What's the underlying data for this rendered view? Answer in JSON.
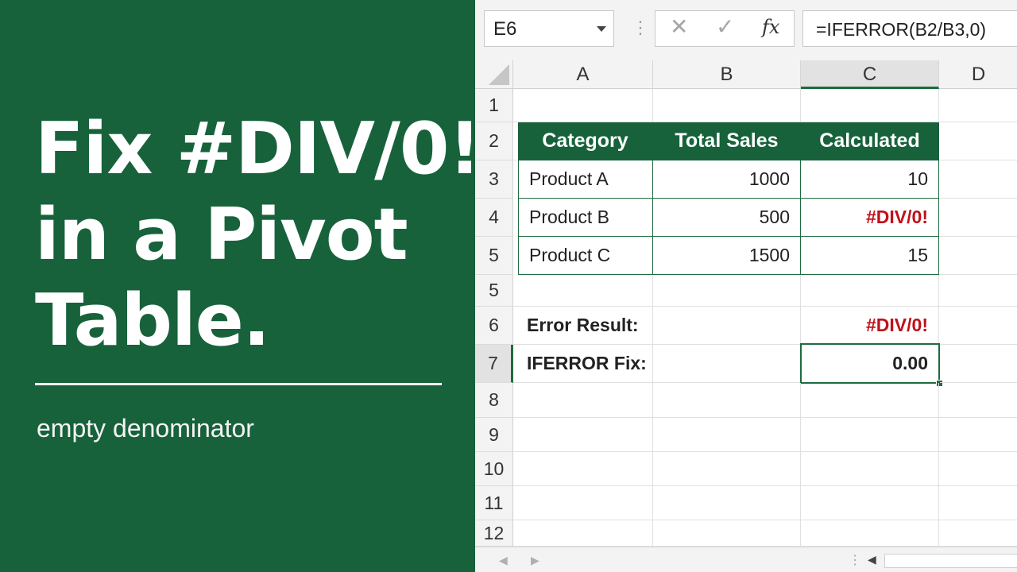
{
  "headline": {
    "line1": "Fix #DIV/0! /",
    "line2": "in a Pivot",
    "line3": "Table.",
    "subtitle": "empty denominator"
  },
  "colors": {
    "panel_green": "#17623b",
    "accent_green": "#1f6b3f",
    "error_red": "#c0111a"
  },
  "formula_bar": {
    "name_box": "E6",
    "formula": "=IFERROR(B2/B3,0)",
    "cancel_icon": "cancel-icon",
    "enter_icon": "enter-icon",
    "function_icon": "fx"
  },
  "columns": [
    "A",
    "B",
    "C",
    "D"
  ],
  "rows": [
    "1",
    "2",
    "3",
    "4",
    "5",
    "5",
    "6",
    "7",
    "8",
    "9",
    "10",
    "11",
    "12"
  ],
  "table": {
    "headers": [
      "Category",
      "Total Sales",
      "Calculated"
    ],
    "rows": [
      [
        "Product A",
        "1000",
        "10"
      ],
      [
        "Product B",
        "500",
        "#DIV/0!"
      ],
      [
        "Product C",
        "1500",
        "15"
      ]
    ]
  },
  "results": {
    "error_label": "Error Result:",
    "error_value": "#DIV/0!",
    "fix_label": "IFERROR Fix:",
    "fix_value": "0.00"
  },
  "bottom_bar": {
    "left_arrow": "◀",
    "right_arrow": "▶",
    "dots": "⋮",
    "scroll_left": "◀"
  }
}
